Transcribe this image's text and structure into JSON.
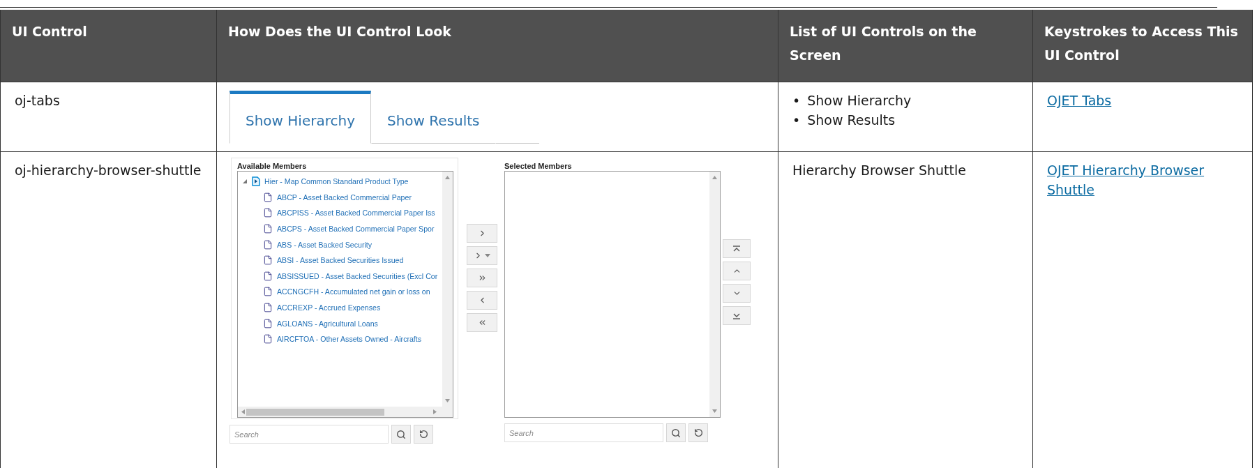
{
  "columns": [
    "UI Control",
    "How Does the UI Control Look",
    "List of UI Controls on the Screen",
    "Keystrokes to Access This UI Control"
  ],
  "rows": [
    {
      "control": "oj-tabs",
      "preview": {
        "kind": "tabs",
        "tabs": [
          {
            "label": "Show Hierarchy",
            "selected": true
          },
          {
            "label": "Show Results",
            "selected": false
          }
        ]
      },
      "controls_list": {
        "kind": "bullets",
        "marker": "•",
        "items": [
          "Show Hierarchy",
          "Show Results"
        ]
      },
      "link": "OJET Tabs"
    },
    {
      "control": "oj-hierarchy-browser-shuttle",
      "preview": {
        "kind": "shuttle",
        "available": {
          "title": "Available Members",
          "root": {
            "label": "Hier - Map Common Standard Product Type",
            "expanded": true,
            "children": [
              "ABCP - Asset Backed Commercial Paper",
              "ABCPISS - Asset Backed Commercial Paper Iss",
              "ABCPS - Asset Backed Commercial Paper Spor",
              "ABS - Asset Backed Security",
              "ABSI - Asset Backed Securities Issued",
              "ABSISSUED - Asset Backed Securities (Excl Cor",
              "ACCNGCFH - Accumulated net gain or loss on",
              "ACCREXP - Accrued Expenses",
              "AGLOANS - Agricultural Loans",
              "AIRCFTOA - Other Assets Owned - Aircrafts"
            ]
          },
          "search": {
            "placeholder": "Search"
          }
        },
        "selected": {
          "title": "Selected Members",
          "search": {
            "placeholder": "Search"
          }
        }
      },
      "controls_list": {
        "kind": "text",
        "text": "Hierarchy Browser Shuttle"
      },
      "link": "OJET Hierarchy Browser Shuttle"
    }
  ]
}
